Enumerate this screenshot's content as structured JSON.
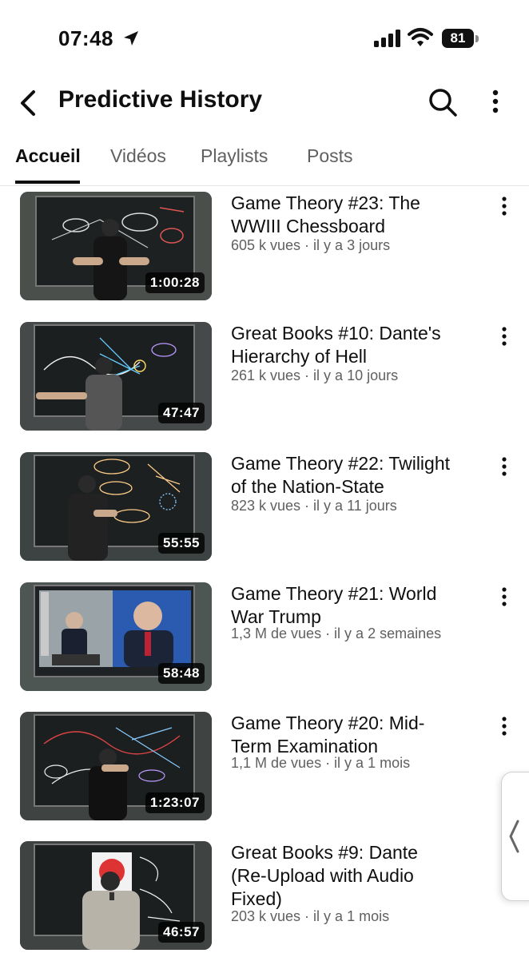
{
  "status_bar": {
    "time": "07:48",
    "battery": "81"
  },
  "header": {
    "title": "Predictive History"
  },
  "tabs": [
    {
      "label": "Accueil",
      "active": true
    },
    {
      "label": "Vidéos",
      "active": false
    },
    {
      "label": "Playlists",
      "active": false
    },
    {
      "label": "Posts",
      "active": false
    }
  ],
  "videos": [
    {
      "title_line1": "Game Theory #23:  The",
      "title_line2": "WWIII Chessboard",
      "title_line3": "",
      "meta": "605 k vues · il y a 3 jours",
      "duration": "1:00:28"
    },
    {
      "title_line1": "Great Books #10:  Dante's",
      "title_line2": "Hierarchy of Hell",
      "title_line3": "",
      "meta": "261 k vues · il y a 10 jours",
      "duration": "47:47"
    },
    {
      "title_line1": "Game Theory #22:  Twilight",
      "title_line2": "of the Nation-State",
      "title_line3": "",
      "meta": "823 k vues · il y a 11 jours",
      "duration": "55:55"
    },
    {
      "title_line1": "Game Theory #21:  World",
      "title_line2": "War Trump",
      "title_line3": "",
      "meta": "1,3 M de vues · il y a 2 semaines",
      "duration": "58:48"
    },
    {
      "title_line1": "Game Theory #20:  Mid-",
      "title_line2": "Term Examination",
      "title_line3": "",
      "meta": "1,1 M de vues · il y a 1 mois",
      "duration": "1:23:07"
    },
    {
      "title_line1": "Great Books #9:  Dante",
      "title_line2": "(Re-Upload with Audio",
      "title_line3": "Fixed)",
      "meta": "203 k vues · il y a 1 mois",
      "duration": "46:57"
    }
  ],
  "colors": {
    "text": "#0f0f0f",
    "secondary": "#606060",
    "divider": "#e3e3e3",
    "chalkboard": "#1e2122"
  },
  "icons": [
    "location-arrow-icon",
    "signal-icon",
    "wifi-icon",
    "battery-icon",
    "back-icon",
    "search-icon",
    "more-vert-icon",
    "chevron-left-icon"
  ]
}
